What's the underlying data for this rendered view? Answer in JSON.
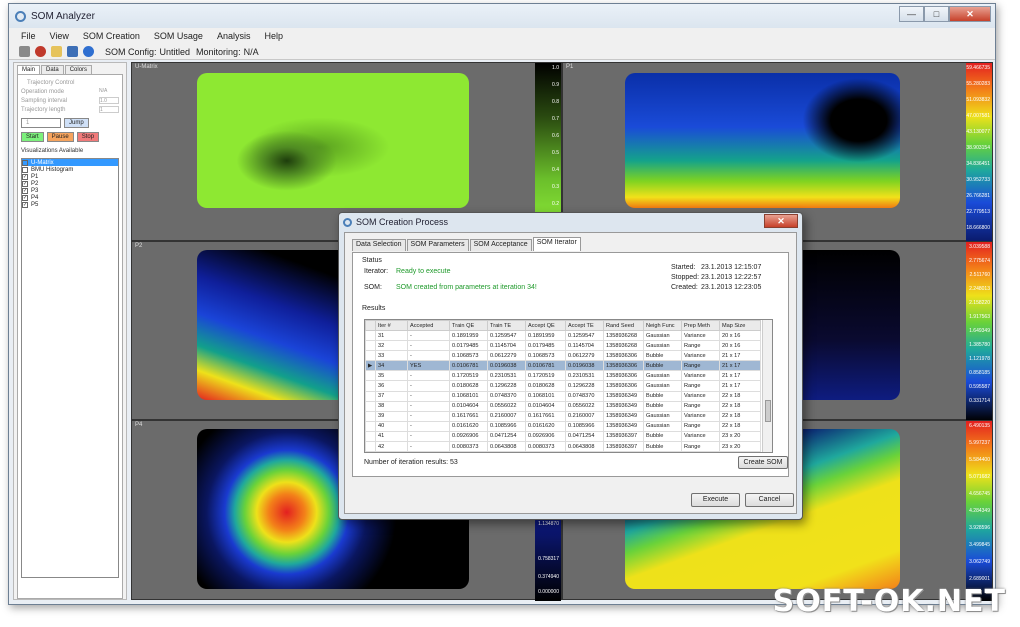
{
  "window": {
    "title": "SOM Analyzer",
    "min": "—",
    "max": "□",
    "close": "✕"
  },
  "menu": [
    "File",
    "View",
    "SOM Creation",
    "SOM Usage",
    "Analysis",
    "Help"
  ],
  "toolbar": {
    "config_label": "SOM Config:",
    "config_value": "Untitled",
    "monitoring_label": "Monitoring:",
    "monitoring_value": "N/A"
  },
  "left_panel": {
    "tabs": [
      "Main",
      "Data",
      "Colors"
    ],
    "group": "Trajectory Control",
    "rows": [
      {
        "label": "Operation mode",
        "value": "N/A"
      },
      {
        "label": "Sampling interval",
        "value": "1.0"
      },
      {
        "label": "Trajectory length",
        "value": "1"
      }
    ],
    "field_value": "1",
    "jump": "Jump",
    "start": "Start",
    "pause": "Pause",
    "stop": "Stop",
    "vis_title": "Visualizations Available",
    "vis_items": [
      {
        "label": "U-Matrix",
        "checked": false,
        "selected": true
      },
      {
        "label": "BMU Histogram",
        "checked": false,
        "selected": false
      },
      {
        "label": "P1",
        "checked": true,
        "selected": false
      },
      {
        "label": "P2",
        "checked": true,
        "selected": false
      },
      {
        "label": "P3",
        "checked": true,
        "selected": false
      },
      {
        "label": "P4",
        "checked": true,
        "selected": false
      },
      {
        "label": "P5",
        "checked": true,
        "selected": false
      }
    ]
  },
  "panels": [
    {
      "label": "U-Matrix",
      "scale": [
        "1.0",
        "0.9",
        "0.8",
        "0.7",
        "0.6",
        "0.5",
        "0.4",
        "0.3",
        "0.2"
      ]
    },
    {
      "label": "P1",
      "scale": [
        "59.466735",
        "55.280283",
        "51.093832",
        "47.007581",
        "43.130077",
        "38.903154",
        "34.836451",
        "30.952733",
        "26.766281",
        "22.779513",
        "18.666800"
      ]
    },
    {
      "label": "P2",
      "scale": [
        "3.039588",
        "2.775674",
        "2.511760",
        "2.248013",
        "2.158220",
        "1.917563",
        "1.649349",
        "1.385780",
        "1.121978",
        "0.858185",
        "0.595587",
        "0.331714"
      ]
    },
    {
      "label": "P3",
      "scale": []
    },
    {
      "label": "P4",
      "scale": [
        "1.134870",
        "0.758317",
        "0.374940",
        "0.000000"
      ]
    },
    {
      "label": "P5",
      "scale": [
        "6.490135",
        "5.997237",
        "5.584400",
        "5.071682",
        "4.656745",
        "4.284349",
        "3.928596",
        "3.499845",
        "3.062749",
        "2.689001"
      ]
    }
  ],
  "dialog": {
    "title": "SOM Creation Process",
    "close": "✕",
    "tabs": [
      "Data Selection",
      "SOM Parameters",
      "SOM Acceptance",
      "SOM Iterator"
    ],
    "status_label": "Status",
    "iterator_label": "Iterator:",
    "iterator_value": "Ready to execute",
    "som_label": "SOM:",
    "som_value": "SOM created from parameters at iteration 34!",
    "started_label": "Started:",
    "started_value": "23.1.2013 12:15:07",
    "stopped_label": "Stopped:",
    "stopped_value": "23.1.2013 12:22:57",
    "created_label": "Created:",
    "created_value": "23.1.2013 12:23:05",
    "results_label": "Results",
    "columns": [
      "Iter #",
      "Accepted",
      "Train QE",
      "Train TE",
      "Accept QE",
      "Accept TE",
      "Rand Seed",
      "Neigh Func",
      "Prep Meth",
      "Map Size"
    ],
    "rows": [
      [
        "31",
        "-",
        "0.1891959",
        "0.1259547",
        "0.1891959",
        "0.1259547",
        "1358936268",
        "Gaussian",
        "Variance",
        "20 x 16"
      ],
      [
        "32",
        "-",
        "0.0179485",
        "0.1145704",
        "0.0179485",
        "0.1145704",
        "1358936268",
        "Gaussian",
        "Range",
        "20 x 16"
      ],
      [
        "33",
        "-",
        "0.1068573",
        "0.0612279",
        "0.1068573",
        "0.0612279",
        "1358936306",
        "Bubble",
        "Variance",
        "21 x 17"
      ],
      [
        "34",
        "YES",
        "0.0106781",
        "0.0196038",
        "0.0106781",
        "0.0196038",
        "1358936306",
        "Bubble",
        "Range",
        "21 x 17"
      ],
      [
        "35",
        "-",
        "0.1720519",
        "0.2310531",
        "0.1720519",
        "0.2310531",
        "1358936306",
        "Gaussian",
        "Variance",
        "21 x 17"
      ],
      [
        "36",
        "-",
        "0.0180628",
        "0.1296228",
        "0.0180628",
        "0.1296228",
        "1358936306",
        "Gaussian",
        "Range",
        "21 x 17"
      ],
      [
        "37",
        "-",
        "0.1068101",
        "0.0748370",
        "0.1068101",
        "0.0748370",
        "1358936349",
        "Bubble",
        "Variance",
        "22 x 18"
      ],
      [
        "38",
        "-",
        "0.0104604",
        "0.0556022",
        "0.0104604",
        "0.0556022",
        "1358936349",
        "Bubble",
        "Range",
        "22 x 18"
      ],
      [
        "39",
        "-",
        "0.1617661",
        "0.2160007",
        "0.1617661",
        "0.2160007",
        "1358936349",
        "Gaussian",
        "Variance",
        "22 x 18"
      ],
      [
        "40",
        "-",
        "0.0161620",
        "0.1085966",
        "0.0161620",
        "0.1085966",
        "1358936349",
        "Gaussian",
        "Range",
        "22 x 18"
      ],
      [
        "41",
        "-",
        "0.0926906",
        "0.0471254",
        "0.0926906",
        "0.0471254",
        "1358936397",
        "Bubble",
        "Variance",
        "23 x 20"
      ],
      [
        "42",
        "-",
        "0.0080373",
        "0.0643808",
        "0.0080373",
        "0.0643808",
        "1358936397",
        "Bubble",
        "Range",
        "23 x 20"
      ],
      [
        "43",
        "-",
        "0.1492173",
        "0.3618725",
        "0.1492173",
        "0.3618725",
        "1358936397",
        "Gaussian",
        "Variance",
        "23 x 20"
      ]
    ],
    "selected_row": 3,
    "count_label": "Number of iteration results: 53",
    "create_som": "Create SOM",
    "execute": "Execute",
    "cancel": "Cancel"
  },
  "watermark": "SOFT-OK.NET"
}
